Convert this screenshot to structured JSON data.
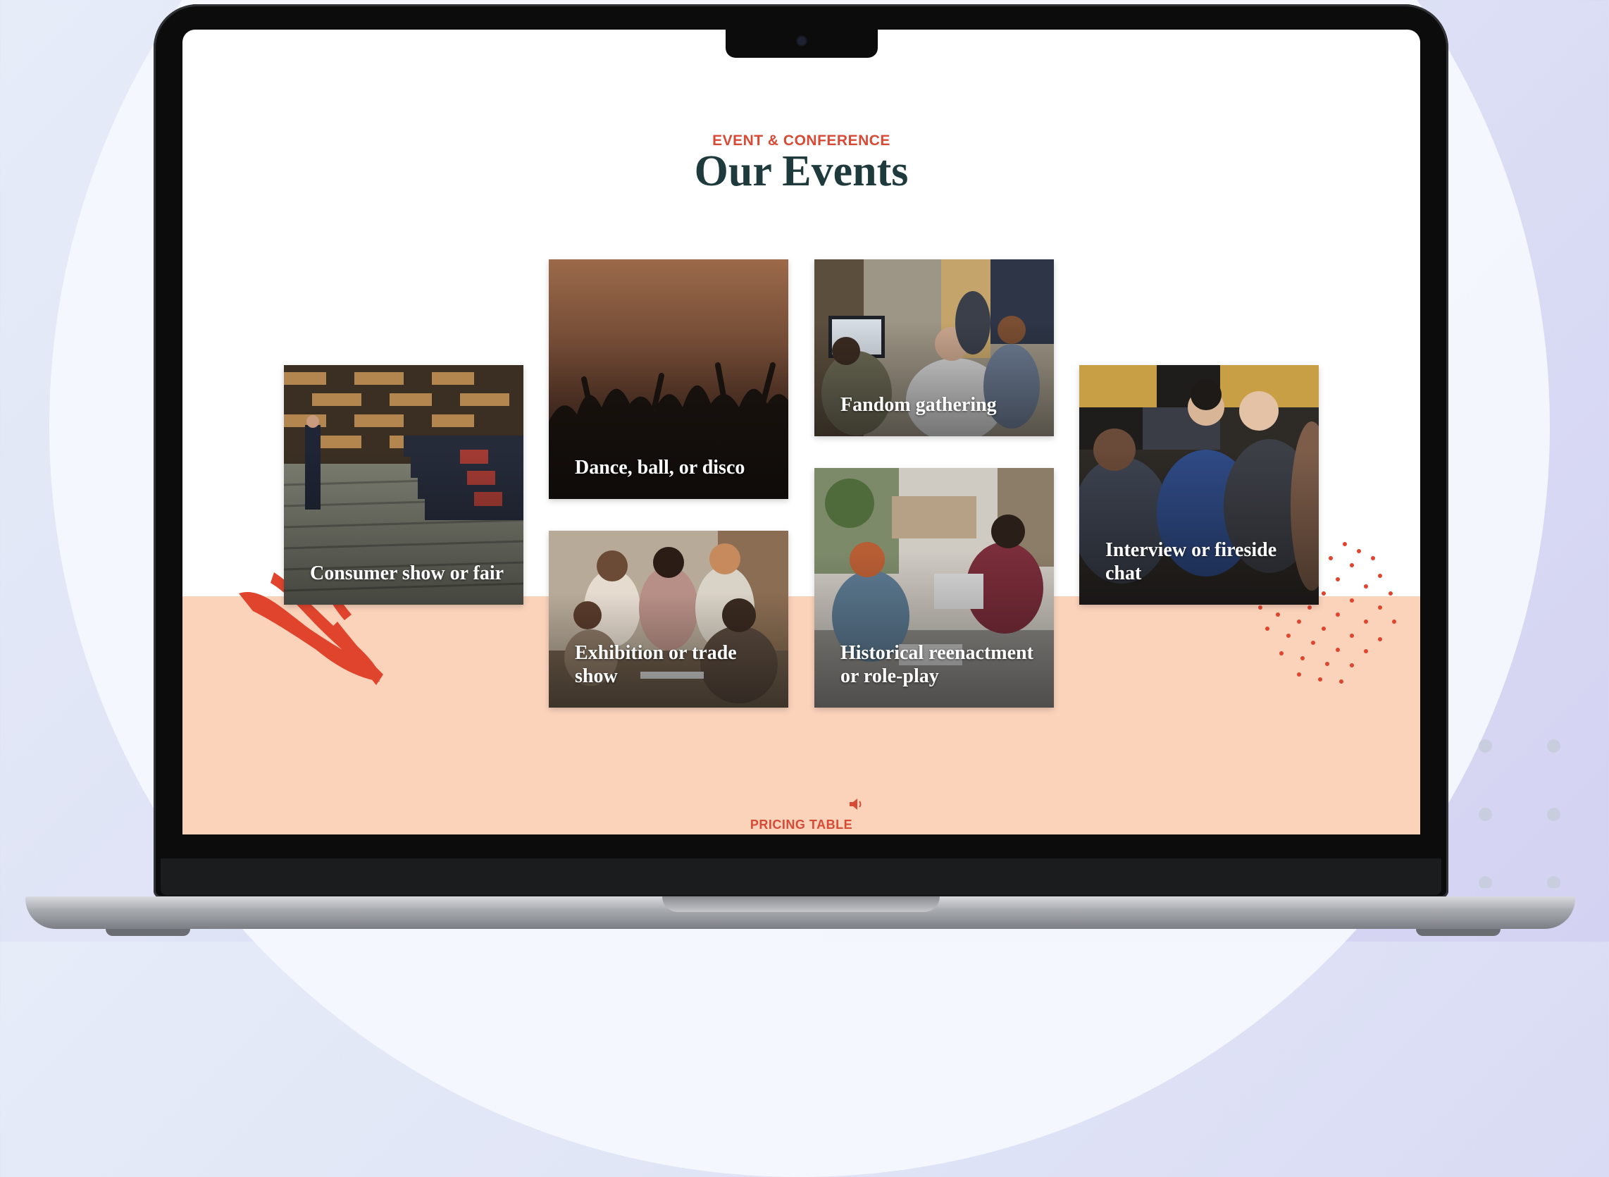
{
  "section": {
    "eyebrow": "EVENT & CONFERENCE",
    "title": "Our Events"
  },
  "events": [
    {
      "label": "Consumer show or fair"
    },
    {
      "label": "Dance, ball, or disco"
    },
    {
      "label": "Exhibition or trade show"
    },
    {
      "label": "Fandom gathering"
    },
    {
      "label": "Historical reenactment or role-play"
    },
    {
      "label": "Interview or fireside chat"
    }
  ],
  "footer": {
    "next_section_label": "PRICING TABLE"
  },
  "colors": {
    "accent": "#d84a35",
    "heading": "#1f3a3c",
    "peach_band": "#fbd3bb"
  }
}
